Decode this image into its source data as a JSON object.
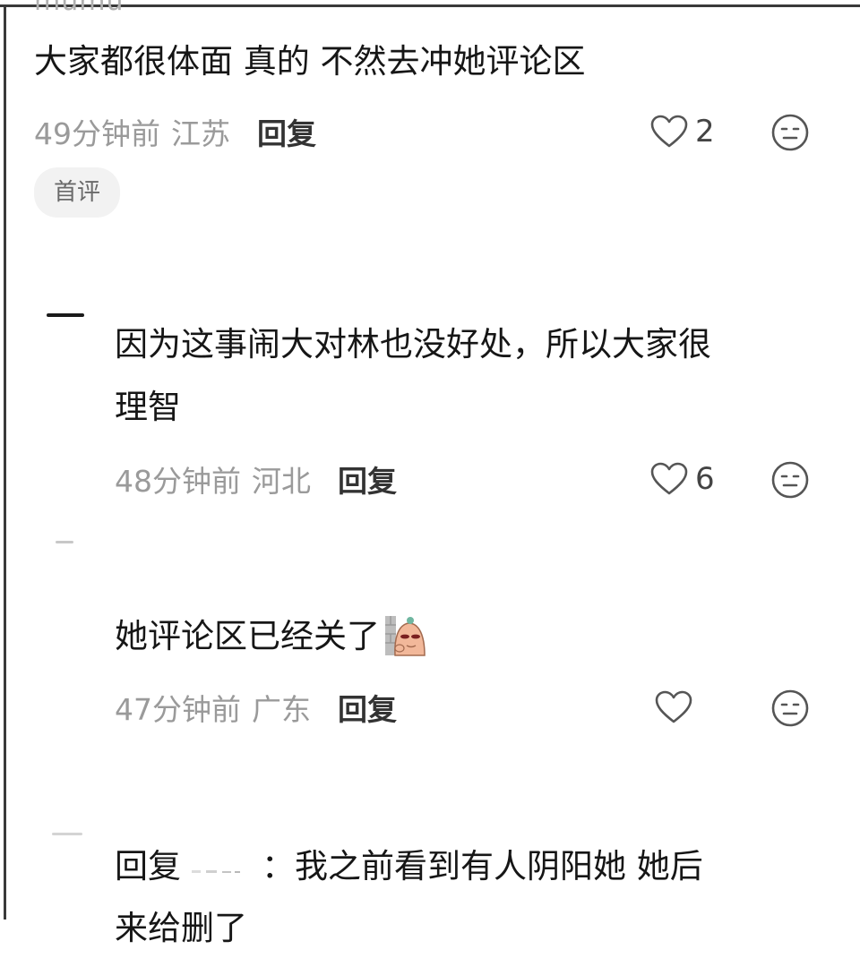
{
  "top_cut_text": "mumu",
  "comments": [
    {
      "text": "大家都很体面 真的 不然去冲她评论区",
      "time": "49分钟前",
      "region": "江苏",
      "reply_label": "回复",
      "likes": "2",
      "badge": "首评"
    },
    {
      "line1": "因为这事闹大对林也没好处，所以大家很",
      "line2": "理智",
      "time": "48分钟前",
      "region": "河北",
      "reply_label": "回复",
      "likes": "6"
    },
    {
      "text": "她评论区已经关了",
      "sticker_icon": "peeking-sticker-icon",
      "time": "47分钟前",
      "region": "广东",
      "reply_label": "回复",
      "likes": ""
    },
    {
      "reply_prefix": "回复",
      "colon": "：",
      "text": "我之前看到有人阴阳她 她后",
      "line2": "来给删了"
    }
  ],
  "colors": {
    "text": "#161616",
    "meta": "#9a9a9a",
    "reply": "#333333",
    "badge_bg": "#f2f2f2"
  },
  "icons": {
    "like": "heart-outline-icon",
    "react": "neutral-face-icon"
  }
}
